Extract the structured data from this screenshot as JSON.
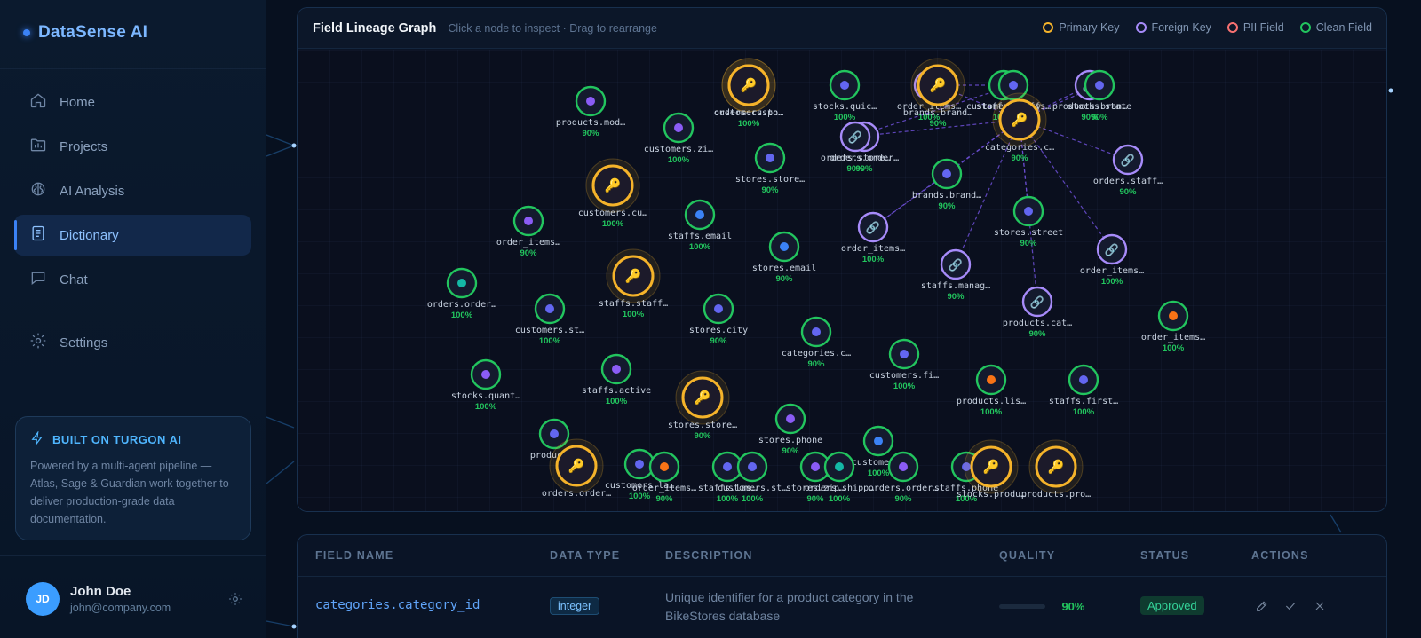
{
  "brand": {
    "name": "DataSense AI"
  },
  "nav": {
    "items": [
      {
        "label": "Home",
        "icon": "home-icon",
        "active": false
      },
      {
        "label": "Projects",
        "icon": "folder-icon",
        "active": false
      },
      {
        "label": "AI Analysis",
        "icon": "brain-icon",
        "active": false
      },
      {
        "label": "Dictionary",
        "icon": "book-icon",
        "active": true
      },
      {
        "label": "Chat",
        "icon": "chat-icon",
        "active": false
      }
    ],
    "settings_label": "Settings"
  },
  "promo": {
    "title": "BUILT ON TURGON AI",
    "body": "Powered by a multi-agent pipeline — Atlas, Sage & Guardian work together to deliver production-grade data documentation."
  },
  "user": {
    "initials": "JD",
    "name": "John Doe",
    "email": "john@company.com"
  },
  "graph": {
    "title": "Field Lineage Graph",
    "subtitle": "Click a node to inspect · Drag to rearrange",
    "legend": [
      {
        "label": "Primary Key",
        "color": "#f5b32a"
      },
      {
        "label": "Foreign Key",
        "color": "#a78bfa"
      },
      {
        "label": "PII Field",
        "color": "#f87171"
      },
      {
        "label": "Clean Field",
        "color": "#22c55e"
      }
    ],
    "nodes": [
      {
        "label": "products.mod…",
        "pct": "90%",
        "kind": "clean",
        "dot": "#8b5cf6"
      },
      {
        "label": "customers.zi…",
        "pct": "100%",
        "kind": "clean",
        "dot": "#8b5cf6"
      },
      {
        "label": "customers.ph…",
        "pct": "",
        "kind": "pk",
        "dot": ""
      },
      {
        "label": "orders.custo…",
        "pct": "100%",
        "kind": "pk",
        "dot": ""
      },
      {
        "label": "stocks.quic…",
        "pct": "100%",
        "kind": "clean",
        "dot": ""
      },
      {
        "label": "orders.order…",
        "pct": "90%",
        "kind": "fk",
        "dot": ""
      },
      {
        "label": "order_items…",
        "pct": "100%",
        "kind": "fk",
        "dot": ""
      },
      {
        "label": "brands.brand…",
        "pct": "90%",
        "kind": "pk",
        "dot": ""
      },
      {
        "label": "customers.city",
        "pct": "100%",
        "kind": "clean",
        "dot": "#6366f1"
      },
      {
        "label": "staffs.staffs…",
        "pct": "100%",
        "kind": "clean",
        "dot": ""
      },
      {
        "label": "products.bran…",
        "pct": "90%",
        "kind": "fk",
        "dot": ""
      },
      {
        "label": "stocks.state",
        "pct": "90%",
        "kind": "clean",
        "dot": ""
      },
      {
        "label": "orders.store…",
        "pct": "90%",
        "kind": "fk",
        "dot": ""
      },
      {
        "label": "categories.c…",
        "pct": "90%",
        "kind": "pk",
        "dot": ""
      },
      {
        "label": "stores.store…",
        "pct": "90%",
        "kind": "clean",
        "dot": "#6366f1"
      },
      {
        "label": "orders.staff…",
        "pct": "90%",
        "kind": "fk",
        "dot": ""
      },
      {
        "label": "brands.brand…",
        "pct": "90%",
        "kind": "clean",
        "dot": "#6366f1"
      },
      {
        "label": "customers.cu…",
        "pct": "100%",
        "kind": "pk",
        "dot": ""
      },
      {
        "label": "staffs.email",
        "pct": "100%",
        "kind": "clean",
        "dot": "#3b82f6"
      },
      {
        "label": "order_items…",
        "pct": "90%",
        "kind": "clean",
        "dot": "#8b5cf6"
      },
      {
        "label": "stores.street",
        "pct": "90%",
        "kind": "clean",
        "dot": "#6366f1"
      },
      {
        "label": "order_items…",
        "pct": "100%",
        "kind": "fk",
        "dot": ""
      },
      {
        "label": "stores.email",
        "pct": "90%",
        "kind": "clean",
        "dot": "#3b82f6"
      },
      {
        "label": "order_items…",
        "pct": "100%",
        "kind": "fk",
        "dot": ""
      },
      {
        "label": "staffs.manag…",
        "pct": "90%",
        "kind": "fk",
        "dot": ""
      },
      {
        "label": "orders.order…",
        "pct": "100%",
        "kind": "clean",
        "dot": "#14b8a6"
      },
      {
        "label": "staffs.staff…",
        "pct": "100%",
        "kind": "pk",
        "dot": ""
      },
      {
        "label": "customers.st…",
        "pct": "100%",
        "kind": "clean",
        "dot": "#6366f1"
      },
      {
        "label": "stores.city",
        "pct": "90%",
        "kind": "clean",
        "dot": "#6366f1"
      },
      {
        "label": "products.cat…",
        "pct": "90%",
        "kind": "fk",
        "dot": ""
      },
      {
        "label": "order_items…",
        "pct": "100%",
        "kind": "clean",
        "dot": "#f97316"
      },
      {
        "label": "categories.c…",
        "pct": "90%",
        "kind": "clean",
        "dot": "#6366f1"
      },
      {
        "label": "customers.fi…",
        "pct": "100%",
        "kind": "clean",
        "dot": "#6366f1"
      },
      {
        "label": "stocks.quant…",
        "pct": "100%",
        "kind": "clean",
        "dot": "#8b5cf6"
      },
      {
        "label": "staffs.active",
        "pct": "100%",
        "kind": "clean",
        "dot": "#8b5cf6"
      },
      {
        "label": "stores.store…",
        "pct": "90%",
        "kind": "pk",
        "dot": ""
      },
      {
        "label": "products.lis…",
        "pct": "100%",
        "kind": "clean",
        "dot": "#f97316"
      },
      {
        "label": "staffs.first…",
        "pct": "100%",
        "kind": "clean",
        "dot": "#6366f1"
      },
      {
        "label": "stores.phone",
        "pct": "90%",
        "kind": "clean",
        "dot": "#8b5cf6"
      },
      {
        "label": "customers…",
        "pct": "100%",
        "kind": "clean",
        "dot": "#3b82f6"
      },
      {
        "label": "products…",
        "pct": "",
        "kind": "clean",
        "dot": "#6366f1"
      },
      {
        "label": "orders.order…",
        "pct": "",
        "kind": "pk",
        "dot": ""
      },
      {
        "label": "customers.la…",
        "pct": "100%",
        "kind": "clean",
        "dot": "#6366f1"
      },
      {
        "label": "order_items…",
        "pct": "90%",
        "kind": "clean",
        "dot": "#f97316"
      },
      {
        "label": "staffs.las…",
        "pct": "100%",
        "kind": "clean",
        "dot": "#6366f1"
      },
      {
        "label": "customers.st…",
        "pct": "100%",
        "kind": "clean",
        "dot": "#6366f1"
      },
      {
        "label": "stores.zip…",
        "pct": "90%",
        "kind": "clean",
        "dot": "#8b5cf6"
      },
      {
        "label": "orders.shipp…",
        "pct": "100%",
        "kind": "clean",
        "dot": "#14b8a6"
      },
      {
        "label": "orders.order…",
        "pct": "90%",
        "kind": "clean",
        "dot": "#8b5cf6"
      },
      {
        "label": "staffs.phone",
        "pct": "100%",
        "kind": "clean",
        "dot": "#6366f1"
      },
      {
        "label": "stocks.produ…",
        "pct": "",
        "kind": "pk",
        "dot": ""
      },
      {
        "label": "products.pro…",
        "pct": "",
        "kind": "pk",
        "dot": ""
      }
    ]
  },
  "table": {
    "headers": [
      "FIELD NAME",
      "DATA TYPE",
      "DESCRIPTION",
      "QUALITY",
      "STATUS",
      "ACTIONS"
    ],
    "rows": [
      {
        "field_name": "categories.category_id",
        "data_type": "integer",
        "description": "Unique identifier for a product category in the BikeStores database",
        "quality": 0.9,
        "quality_label": "90%",
        "status": "Approved"
      }
    ]
  }
}
